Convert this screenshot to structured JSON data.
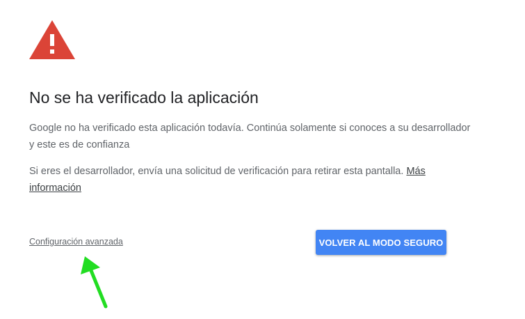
{
  "warning": {
    "icon": "warning-triangle-icon",
    "color": "#db4437"
  },
  "title": "No se ha verificado la aplicación",
  "description": "Google no ha verificado esta aplicación todavía. Continúa solamente si conoces a su desarrollador y este es de confianza",
  "developer_note": {
    "text": "Si eres el desarrollador, envía una solicitud de verificación para retirar esta pantalla. ",
    "link_label": "Más información"
  },
  "advanced_link": "Configuración avanzada",
  "back_button": {
    "label": "VOLVER AL MODO SEGURO",
    "color": "#4285f4"
  },
  "annotation": {
    "icon": "green-arrow-icon",
    "color": "#22dd22"
  }
}
